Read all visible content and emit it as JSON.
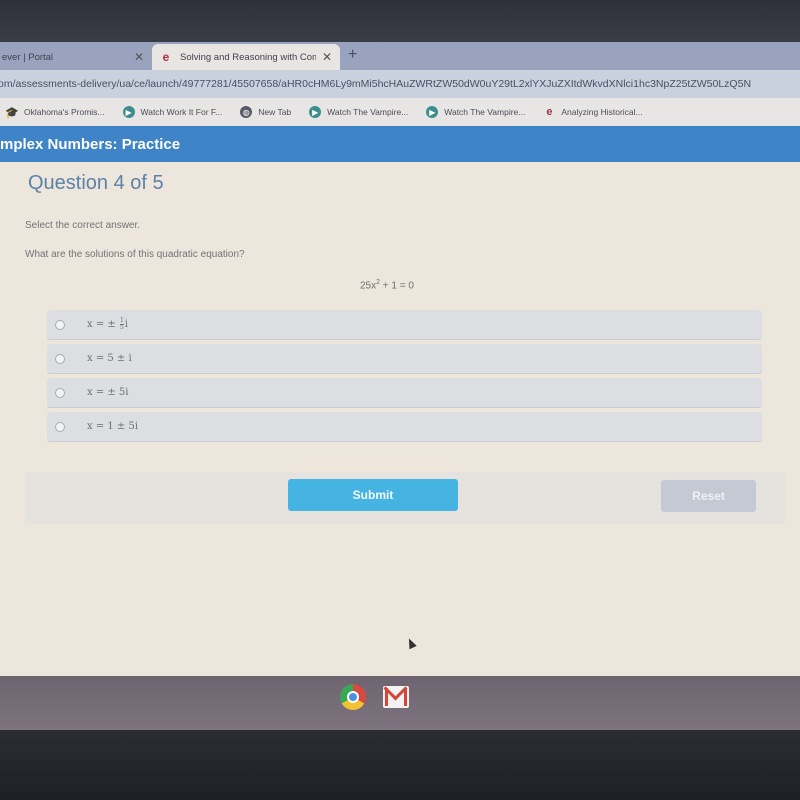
{
  "browser": {
    "tabs": [
      {
        "label": "ever | Portal",
        "active": false
      },
      {
        "label": "Solving and Reasoning with Com",
        "active": true,
        "favicon": "edge-icon"
      }
    ],
    "new_tab_label": "+",
    "close_glyph": "✕",
    "url": "om/assessments-delivery/ua/ce/launch/49777281/45507658/aHR0cHM6Ly9mMi5hcHAuZWRtZW50dW0uY29tL2xlYXJuZXItdWkvdXNlci1hc3NpZ25tZW50LzQ5N",
    "bookmarks": [
      {
        "label": "Oklahoma's Promis...",
        "icon": "school-icon"
      },
      {
        "label": "Watch Work It For F...",
        "icon": "play-icon"
      },
      {
        "label": "New Tab",
        "icon": "globe-icon"
      },
      {
        "label": "Watch The Vampire...",
        "icon": "play-icon"
      },
      {
        "label": "Watch The Vampire...",
        "icon": "play-icon"
      },
      {
        "label": "Analyzing Historical...",
        "icon": "edge-icon"
      }
    ]
  },
  "course": {
    "title": "mplex Numbers: Practice"
  },
  "question": {
    "title": "Question 4 of 5",
    "instruction": "Select the correct answer.",
    "prompt": "What are the solutions of this quadratic equation?",
    "equation": {
      "lhs": "25x",
      "exp": "2",
      "rest": " + 1 = 0"
    },
    "options": [
      {
        "prefix": "x  =  ±",
        "frac_num": "1",
        "frac_den": "5",
        "suffix": "i",
        "selected": false
      },
      {
        "text": "x  =  5 ± i",
        "selected": false
      },
      {
        "text": "x  =  ± 5i",
        "selected": false
      },
      {
        "text": "x  =  1 ± 5i",
        "selected": false
      }
    ]
  },
  "actions": {
    "submit_label": "Submit",
    "reset_label": "Reset"
  },
  "colors": {
    "header_blue": "#3e84c6",
    "submit_blue": "#45b4e3",
    "title_blue": "#5b82a8"
  }
}
